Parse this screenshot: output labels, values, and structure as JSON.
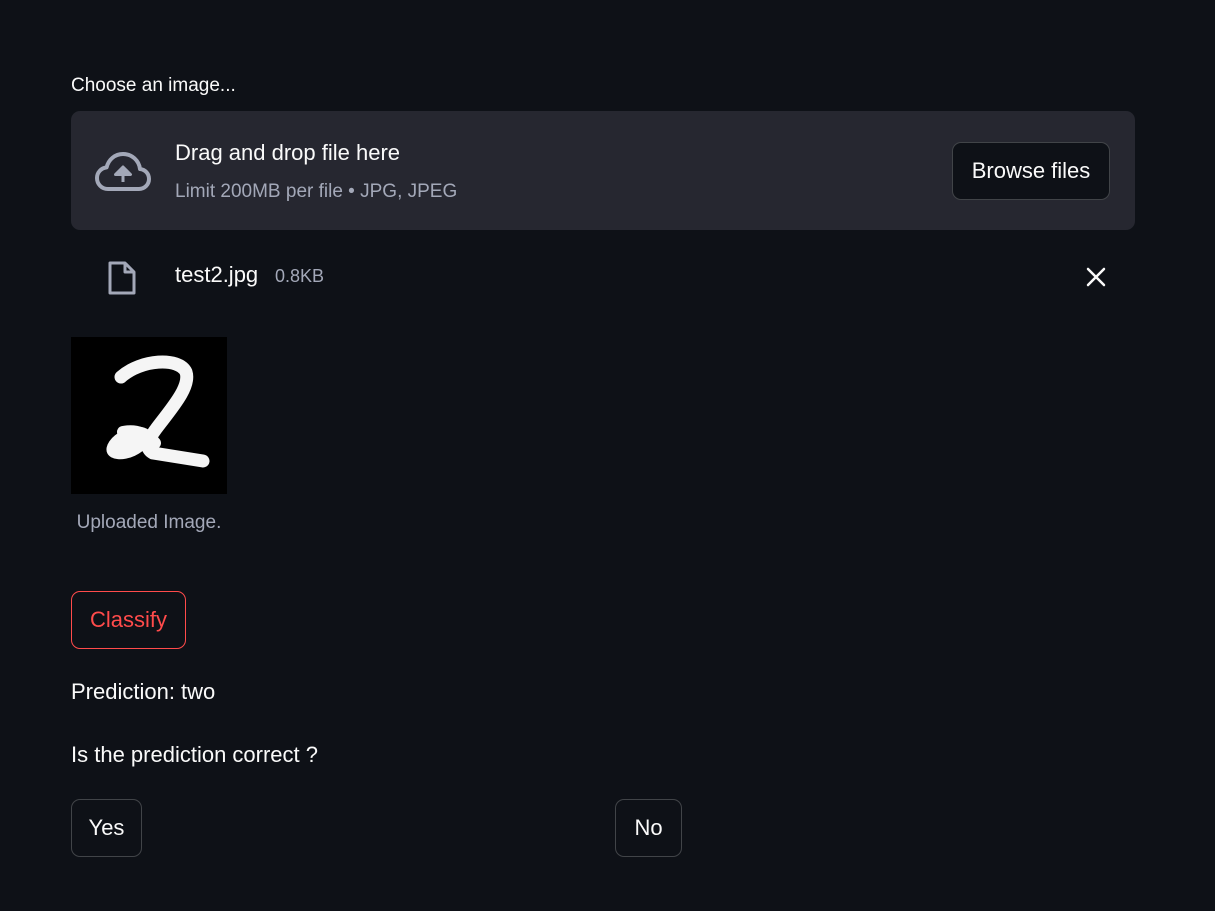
{
  "uploader": {
    "label": "Choose an image...",
    "dropzone_title": "Drag and drop file here",
    "dropzone_limit": "Limit 200MB per file • JPG, JPEG",
    "browse_label": "Browse files",
    "icon": "cloud-upload-icon"
  },
  "uploaded_file": {
    "name": "test2.jpg",
    "size": "0.8KB",
    "icon": "file-icon",
    "remove_icon": "close-icon"
  },
  "image": {
    "caption": "Uploaded Image.",
    "depicts": "2"
  },
  "classify": {
    "label": "Classify"
  },
  "result": {
    "prediction": "Prediction: two",
    "question": "Is the prediction correct ?"
  },
  "feedback": {
    "yes_label": "Yes",
    "no_label": "No"
  },
  "colors": {
    "background": "#0e1117",
    "dropzone": "#262730",
    "accent": "#ff4b4b",
    "muted_text": "#a3a8b8"
  }
}
